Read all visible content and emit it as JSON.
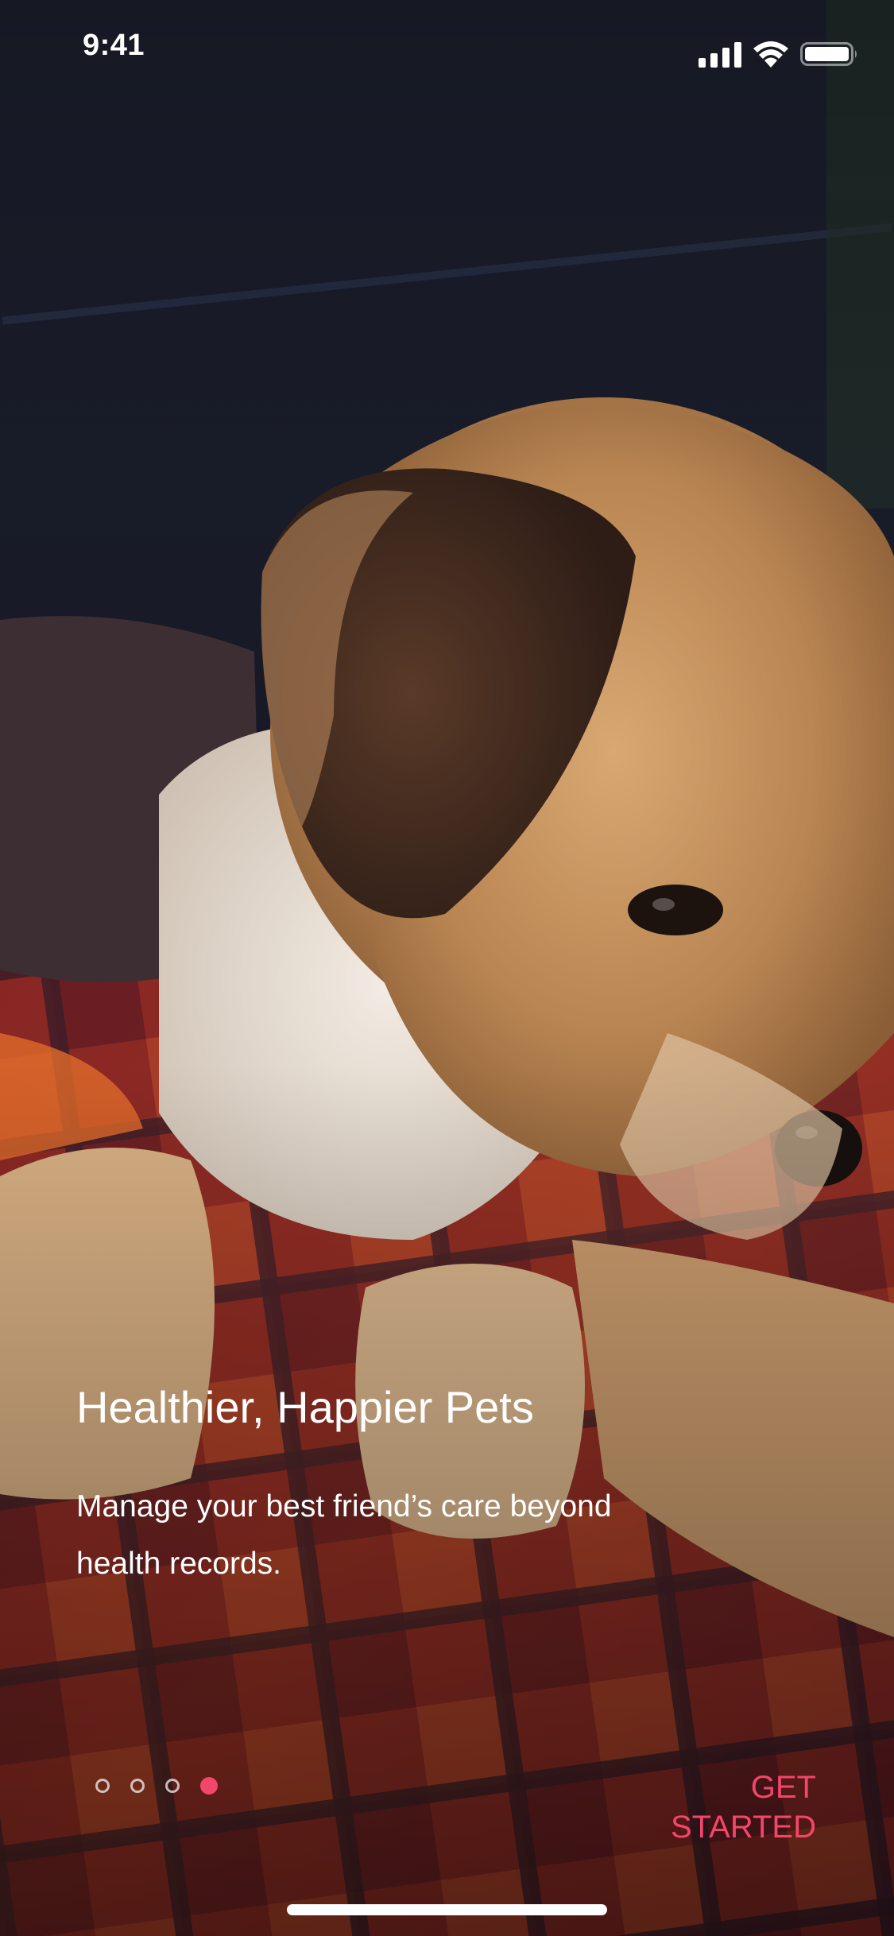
{
  "status_bar": {
    "time": "9:41",
    "signal_icon": "cellular-signal-icon",
    "wifi_icon": "wifi-icon",
    "battery_icon": "battery-icon"
  },
  "onboarding": {
    "title": "Healthier, Happier Pets",
    "description": "Manage your best friend’s care beyond health records.",
    "background_image": "puppy-photo"
  },
  "pager": {
    "total_pages": 4,
    "current_page": 4
  },
  "cta": {
    "label": "GET STARTED"
  },
  "colors": {
    "accent": "#F2466B",
    "text": "#FFFFFF"
  }
}
